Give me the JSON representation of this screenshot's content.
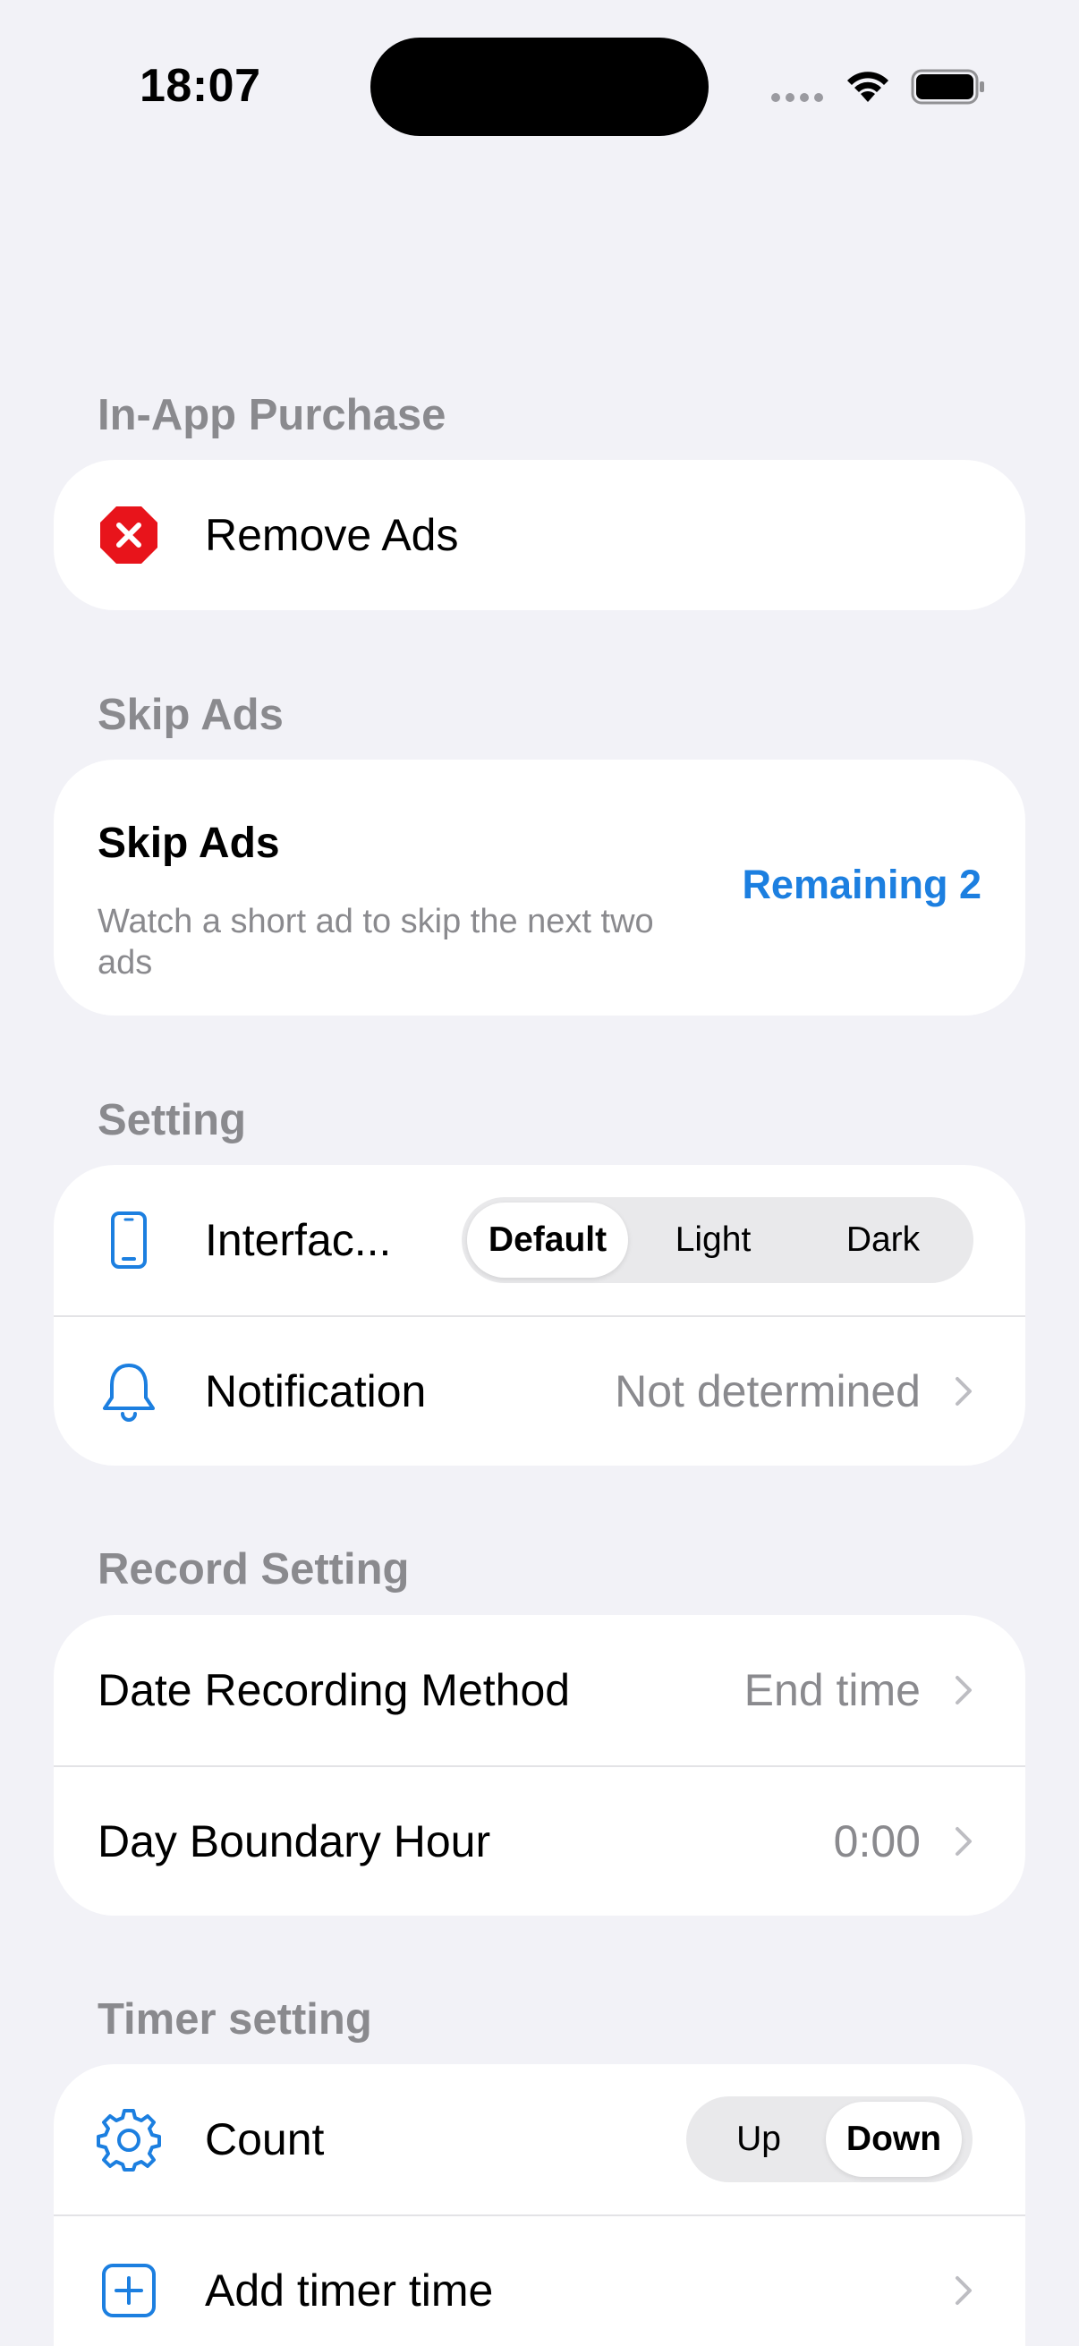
{
  "status_bar": {
    "time": "18:07"
  },
  "sections": {
    "in_app_purchase": {
      "header": "In-App Purchase",
      "remove_ads_label": "Remove Ads"
    },
    "skip_ads": {
      "header": "Skip Ads",
      "title": "Skip Ads",
      "description": "Watch a short ad to skip the next two ads",
      "remaining": "Remaining 2"
    },
    "setting": {
      "header": "Setting",
      "interface_label": "Interfac...",
      "interface_options": [
        "Default",
        "Light",
        "Dark"
      ],
      "interface_selected": "Default",
      "notification_label": "Notification",
      "notification_value": "Not determined"
    },
    "record_setting": {
      "header": "Record Setting",
      "date_method_label": "Date Recording Method",
      "date_method_value": "End time",
      "day_boundary_label": "Day Boundary Hour",
      "day_boundary_value": "0:00"
    },
    "timer_setting": {
      "header": "Timer setting",
      "count_label": "Count",
      "count_options": [
        "Up",
        "Down"
      ],
      "count_selected": "Down",
      "add_timer_label": "Add timer time"
    }
  },
  "colors": {
    "accent": "#1c7fe0",
    "destructive": "#e8141b",
    "secondary_text": "#8a8a8e",
    "background": "#f2f2f7"
  },
  "icons": {
    "remove_ads": "xmark-octagon-icon",
    "interface": "phone-icon",
    "notification": "bell-icon",
    "count": "gear-icon",
    "add_timer": "plus-square-icon"
  }
}
